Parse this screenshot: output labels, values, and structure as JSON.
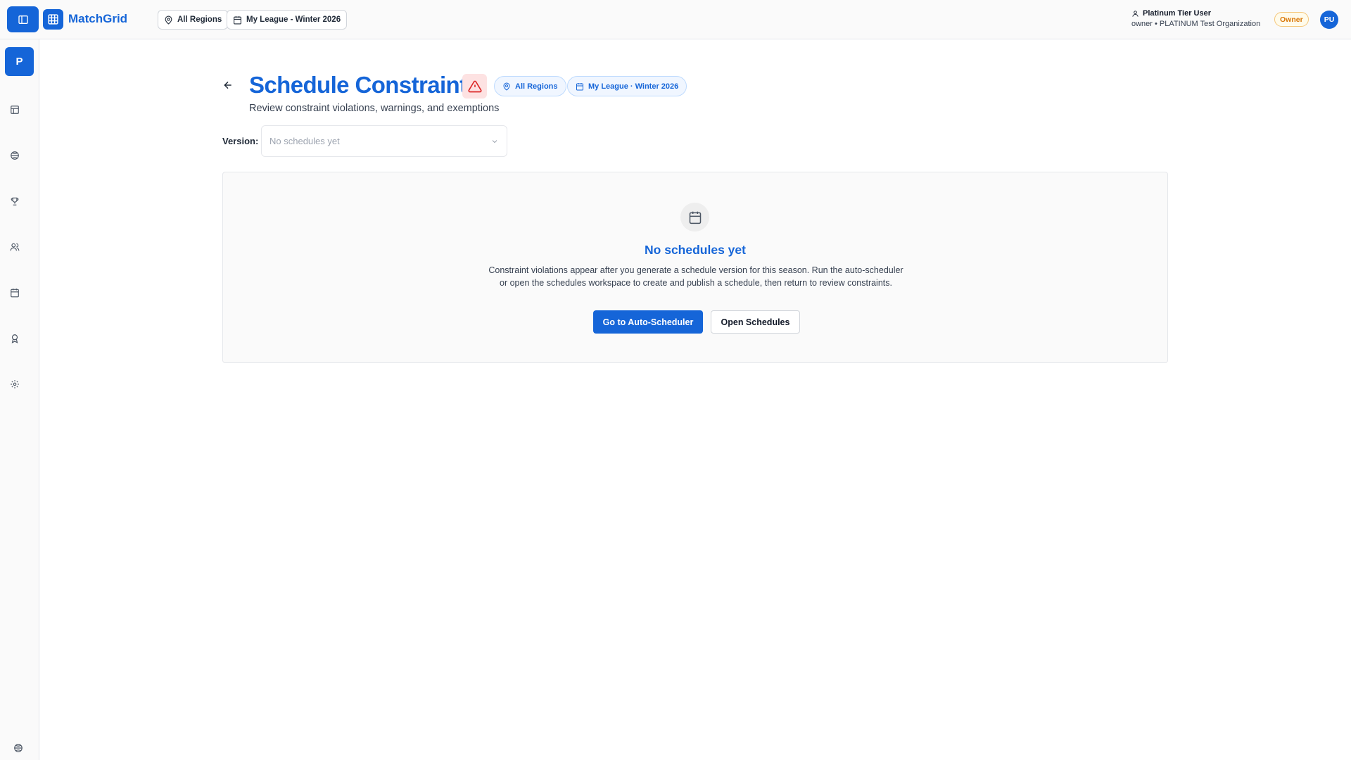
{
  "app": {
    "name": "MatchGrid",
    "brand_color": "#1565d8"
  },
  "topbar": {
    "region_filter": "All Regions",
    "season_filter": "My League - Winter 2026",
    "user": {
      "name": "Platinum Tier User",
      "subtitle": "owner • PLATINUM Test Organization",
      "role_badge": "Owner",
      "initials": "PU"
    }
  },
  "sidebar": {
    "org_initial": "P",
    "items": [
      {
        "icon": "dashboard-icon"
      },
      {
        "icon": "sports-ball-icon"
      },
      {
        "icon": "trophy-icon"
      },
      {
        "icon": "users-icon"
      },
      {
        "icon": "calendar-icon"
      },
      {
        "icon": "award-icon"
      },
      {
        "icon": "settings-icon"
      }
    ],
    "footer_icon": "sports-ball-icon"
  },
  "page": {
    "title": "Schedule Constraints",
    "subtitle": "Review constraint violations, warnings, and exemptions",
    "region_chip": "All Regions",
    "season_chip": "My League · Winter 2026",
    "warning_color": "#dc2626"
  },
  "version": {
    "label": "Version:",
    "selected": "No schedules yet"
  },
  "empty_state": {
    "title": "No schedules yet",
    "description": "Constraint violations appear after you generate a schedule version for this season. Run the auto-scheduler or open the schedules workspace to create and publish a schedule, then return to review constraints.",
    "primary_action": "Go to Auto-Scheduler",
    "secondary_action": "Open Schedules"
  }
}
